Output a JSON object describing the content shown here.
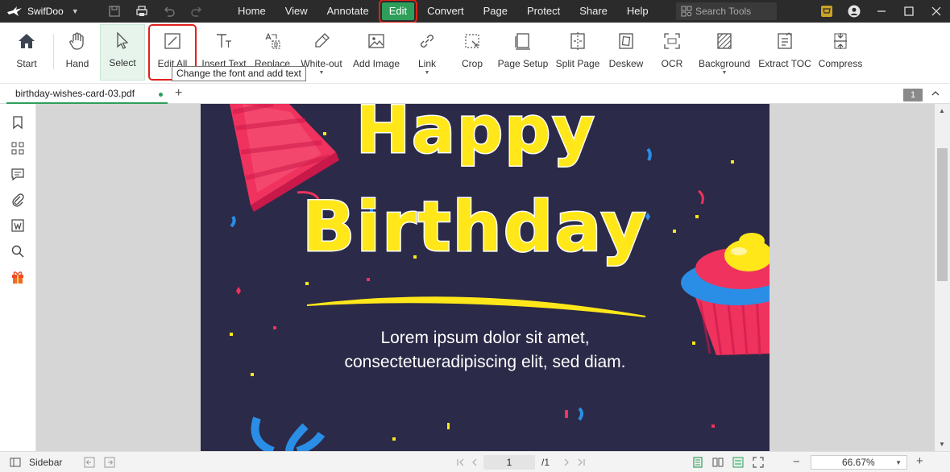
{
  "app": {
    "name": "SwifDoo"
  },
  "menu": [
    "Home",
    "View",
    "Annotate",
    "Edit",
    "Convert",
    "Page",
    "Protect",
    "Share",
    "Help"
  ],
  "active_menu": "Edit",
  "search": {
    "placeholder": "Search Tools"
  },
  "ribbon": {
    "start": "Start",
    "hand": "Hand",
    "select": "Select",
    "edit_all": "Edit All",
    "insert_text": "Insert Text",
    "replace": "Replace",
    "white_out": "White-out",
    "add_image": "Add Image",
    "link": "Link",
    "crop": "Crop",
    "page_setup": "Page Setup",
    "split_page": "Split Page",
    "deskew": "Deskew",
    "ocr": "OCR",
    "background": "Background",
    "extract_toc": "Extract TOC",
    "compress": "Compress"
  },
  "tooltip": "Change the font and add text",
  "tab": {
    "filename": "birthday-wishes-card-03.pdf"
  },
  "page_count_badge": "1",
  "document": {
    "title_line1": "Happy",
    "title_line2": "Birthday",
    "body_line1": "Lorem ipsum dolor sit amet,",
    "body_line2": "consectetueradipiscing elit, sed diam."
  },
  "statusbar": {
    "sidebar": "Sidebar",
    "current_page": "1",
    "total_pages": "/1",
    "zoom": "66.67%"
  },
  "colors": {
    "accent": "#2e9e5b",
    "highlight": "#e0221b",
    "card_bg": "#2b2a48",
    "title_yellow": "#ffe71a"
  }
}
